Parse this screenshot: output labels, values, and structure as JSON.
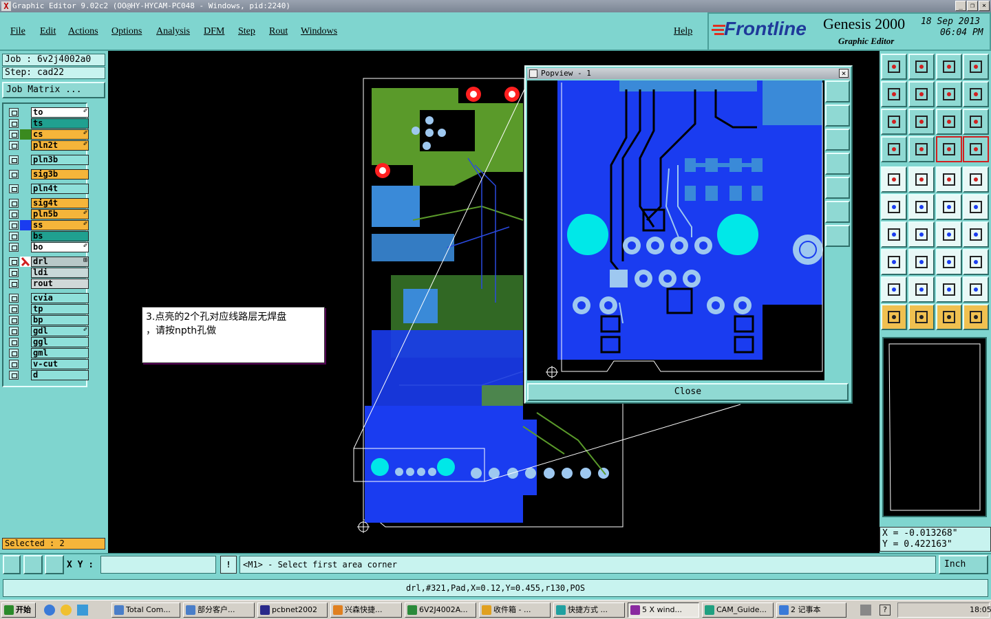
{
  "window": {
    "title": "Graphic Editor 9.02c2 (OO@HY-HYCAM-PC048 - Windows, pid:2240)",
    "min": "_",
    "restore": "❐",
    "close": "×"
  },
  "menu": {
    "items": [
      "File",
      "Edit",
      "Actions",
      "Options",
      "Analysis",
      "DFM",
      "Step",
      "Rout",
      "Windows"
    ],
    "help": "Help"
  },
  "brand": {
    "logo": "Frontline",
    "product": "Genesis 2000",
    "subtitle": "Graphic Editor",
    "date": "18 Sep 2013",
    "time": "06:04 PM"
  },
  "job": {
    "job": "Job : 6v2j4002a0",
    "step": "Step: cad22",
    "matrix_button": "Job Matrix ..."
  },
  "layers": [
    {
      "name": "to",
      "color": "#ffffff",
      "swatch": "",
      "mark": "✐"
    },
    {
      "name": "ts",
      "color": "#20a090",
      "swatch": "",
      "mark": ""
    },
    {
      "name": "cs",
      "color": "#f5b53a",
      "swatch": "#3a8a1f",
      "mark": "✐"
    },
    {
      "name": "pln2t",
      "color": "#f5b53a",
      "swatch": "",
      "mark": "✐"
    },
    {
      "name": "pln3b",
      "color": "#8fe0da",
      "swatch": "",
      "mark": ""
    },
    {
      "name": "sig3b",
      "color": "#f5b53a",
      "swatch": "",
      "mark": ""
    },
    {
      "name": "pln4t",
      "color": "#8fe0da",
      "swatch": "",
      "mark": ""
    },
    {
      "name": "sig4t",
      "color": "#f5b53a",
      "swatch": "",
      "mark": ""
    },
    {
      "name": "pln5b",
      "color": "#f5b53a",
      "swatch": "",
      "mark": "✐"
    },
    {
      "name": "ss",
      "color": "#f5b53a",
      "swatch": "#1a3cf0",
      "mark": "✐"
    },
    {
      "name": "bs",
      "color": "#20a090",
      "swatch": "",
      "mark": ""
    },
    {
      "name": "bo",
      "color": "#ffffff",
      "swatch": "",
      "mark": "✐"
    },
    {
      "name": "drl",
      "color": "#b8c8c8",
      "swatch": "",
      "mark": "⊞"
    },
    {
      "name": "ldi",
      "color": "#c8d8d8",
      "swatch": "",
      "mark": ""
    },
    {
      "name": "rout",
      "color": "#d0d8d8",
      "swatch": "",
      "mark": ""
    },
    {
      "name": "cvia",
      "color": "#8fe0da",
      "swatch": "",
      "mark": ""
    },
    {
      "name": "tp",
      "color": "#8fe0da",
      "swatch": "",
      "mark": ""
    },
    {
      "name": "bp",
      "color": "#8fe0da",
      "swatch": "",
      "mark": ""
    },
    {
      "name": "gdl",
      "color": "#8fe0da",
      "swatch": "",
      "mark": "✐"
    },
    {
      "name": "ggl",
      "color": "#8fe0da",
      "swatch": "",
      "mark": ""
    },
    {
      "name": "gml",
      "color": "#8fe0da",
      "swatch": "",
      "mark": ""
    },
    {
      "name": "v-cut",
      "color": "#8fe0da",
      "swatch": "",
      "mark": ""
    },
    {
      "name": "d",
      "color": "#8fe0da",
      "swatch": "",
      "mark": ""
    }
  ],
  "status": {
    "selected": "Selected : 2",
    "xy_label": "X Y :",
    "xy_value": "",
    "prompt": "<M1> - Select first area corner",
    "units": "Inch",
    "info": "drl,#321,Pad,X=0.12,Y=0.455,r130,POS"
  },
  "coords": {
    "x": "X = -0.013268\"",
    "y": "Y = 0.422163\""
  },
  "annotation": {
    "line1": "3.点亮的2个孔对应线路层无焊盘",
    "line2": "，请按npth孔做"
  },
  "popview": {
    "title": "Popview - 1",
    "close_button": "Close"
  },
  "taskbar": {
    "start": "开始",
    "tasks": [
      "Total Com...",
      "部分客户...",
      "pcbnet2002",
      "兴森快捷...",
      "6V2J4002A...",
      "收件箱 - ...",
      "快捷方式 ...",
      "5 X wind...",
      "CAM_Guide...",
      "2 记事本"
    ],
    "clock": "18:05"
  },
  "colors": {
    "panel": "#7fd5cf",
    "blue_layer": "#1a3cf0",
    "green_layer": "#5a9a2a",
    "pad": "#00e8e8"
  }
}
